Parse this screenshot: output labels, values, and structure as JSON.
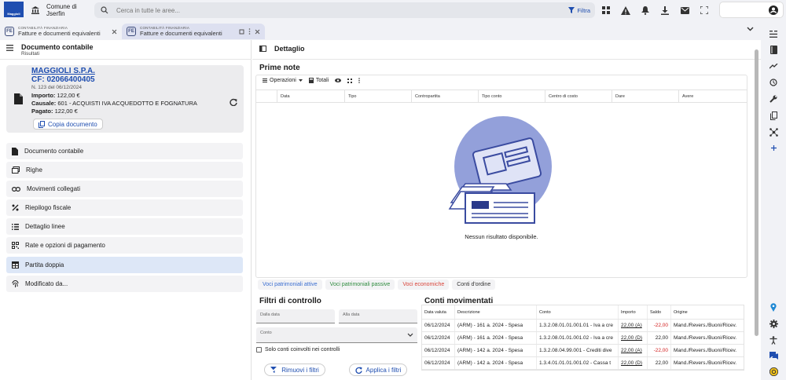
{
  "app": {
    "logo_text": "Maggioli",
    "comune": "Comune di Jserfin",
    "search_placeholder": "Cerca in tutte le aree...",
    "filter_label": "Filtra"
  },
  "tabs": [
    {
      "subtitle": "CONTABILITÀ FINANZIARIA",
      "title": "Fatture e documenti equivalenti"
    },
    {
      "subtitle": "CONTABILITÀ FINANZIARIA",
      "title": "Fatture e documenti equivalenti"
    }
  ],
  "left": {
    "title": "Documento contabile",
    "subtitle": "Risultati",
    "card": {
      "supplier": "MAGGIOLI S.P.A.",
      "cf": "CF: 02066400405",
      "number": "N. 123 del 06/12/2024",
      "importo_label": "Importo:",
      "importo": "122,00 €",
      "causale_label": "Causale:",
      "causale": "601 - ACQUISTI IVA ACQUEDOTTO E FOGNATURA",
      "pagato_label": "Pagato:",
      "pagato": "122,00 €",
      "copy_label": "Copia documento"
    },
    "nav": [
      {
        "label": "Documento contabile",
        "icon": "document-icon"
      },
      {
        "label": "Righe",
        "icon": "rows-icon"
      },
      {
        "label": "Movimenti collegati",
        "icon": "link-icon"
      },
      {
        "label": "Riepilogo fiscale",
        "icon": "percent-icon"
      },
      {
        "label": "Dettaglio linee",
        "icon": "list-icon"
      },
      {
        "label": "Rate e opzioni di pagamento",
        "icon": "qr-icon"
      },
      {
        "label": "Partita doppia",
        "icon": "grid-icon"
      },
      {
        "label": "Modificato da...",
        "icon": "fingerprint-icon"
      }
    ]
  },
  "right": {
    "header": "Dettaglio",
    "prime_note": {
      "title": "Prime note",
      "toolbar": {
        "operations": "Operazioni",
        "totals": "Totali"
      },
      "columns": [
        "",
        "Data",
        "Tipo",
        "Contropartita",
        "Tipo conto",
        "Centro di costo",
        "Dare",
        "Avere"
      ],
      "empty": "Nessun risultato disponibile."
    },
    "legend": [
      {
        "label": "Voci patrimoniali attive",
        "color": "#3c6fd1"
      },
      {
        "label": "Voci patrimoniali passive",
        "color": "#2e8b3e"
      },
      {
        "label": "Voci economiche",
        "color": "#d9443a"
      },
      {
        "label": "Conti d'ordine",
        "color": "#333333"
      }
    ],
    "filters": {
      "title": "Filtri di controllo",
      "from": "Dalla data",
      "to": "Alla data",
      "account": "Conto",
      "only_checked": "Solo conti coinvolti nei controlli",
      "remove": "Rimuovi i filtri",
      "apply": "Applica i filtri"
    },
    "accounts": {
      "title": "Conti movimentati",
      "columns": [
        "Data valuta",
        "Descrizione",
        "Conto",
        "Importo",
        "Saldo",
        "Origine"
      ],
      "rows": [
        [
          "06/12/2024",
          "(ARM) - 161 a. 2024 - Spesa",
          "1.3.2.08.01.01.001.01 - Iva a cre",
          "22,00 (A)",
          "-22,00",
          "Mand./Revers./Buoni/Ricev."
        ],
        [
          "06/12/2024",
          "(ARM) - 161 a. 2024 - Spesa",
          "1.3.2.08.01.01.001.02 - Iva a cre",
          "22,00 (D)",
          "22,00",
          "Mand./Revers./Buoni/Ricev."
        ],
        [
          "06/12/2024",
          "(ARM) - 142 a. 2024 - Spesa",
          "1.3.2.08.04.99.001 - Crediti dive",
          "22,00 (A)",
          "-22,00",
          "Mand./Revers./Buoni/Ricev."
        ],
        [
          "06/12/2024",
          "(ARM) - 142 a. 2024 - Spesa",
          "1.3.4.01.01.01.001.02 - Cassa t",
          "22,00 (D)",
          "22,00",
          "Mand./Revers./Buoni/Ricev."
        ]
      ]
    }
  }
}
